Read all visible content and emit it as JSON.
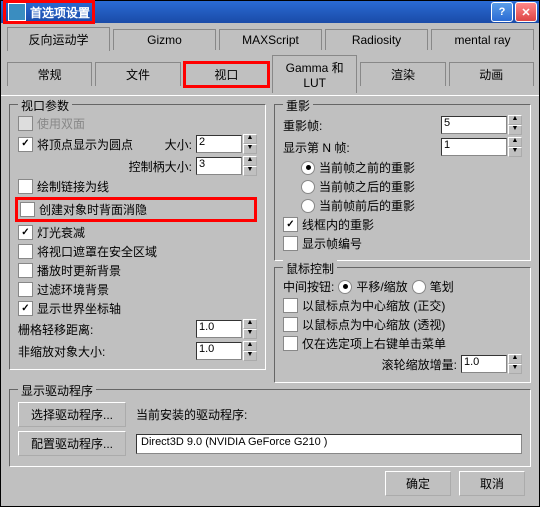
{
  "titlebar": {
    "title": "首选项设置"
  },
  "tabs_row1": [
    "反向运动学",
    "Gizmo",
    "MAXScript",
    "Radiosity",
    "mental ray"
  ],
  "tabs_row2": [
    "常规",
    "文件",
    "视口",
    "Gamma 和 LUT",
    "渲染",
    "动画"
  ],
  "active_tab": "视口",
  "vp_params": {
    "legend": "视口参数",
    "use_double": "使用双面",
    "vert_dots": "将顶点显示为圆点",
    "size_lbl": "大小:",
    "size_val": "2",
    "handle_lbl": "控制柄大小:",
    "handle_val": "3",
    "draw_links": "绘制链接为线",
    "backface": "创建对象时背面消隐",
    "light_atten": "灯光衰减",
    "safe_mask": "将视口遮罩在安全区域",
    "update_bg": "播放时更新背景",
    "filter_bg": "过滤环境背景",
    "world_axis": "显示世界坐标轴",
    "grid_dist_lbl": "栅格轻移距离:",
    "grid_dist_val": "1.0",
    "nonscale_lbl": "非缩放对象大小:",
    "nonscale_val": "1.0"
  },
  "ghost": {
    "legend": "重影",
    "frames_lbl": "重影帧:",
    "frames_val": "5",
    "nth_lbl": "显示第 N 帧:",
    "nth_val": "1",
    "before": "当前帧之前的重影",
    "after": "当前帧之后的重影",
    "both": "当前帧前后的重影",
    "wire": "线框内的重影",
    "show_num": "显示帧编号"
  },
  "mouse": {
    "legend": "鼠标控制",
    "mid_lbl": "中间按钮:",
    "pan": "平移/缩放",
    "stroke": "笔划",
    "center_ortho": "以鼠标点为中心缩放 (正交)",
    "center_persp": "以鼠标点为中心缩放 (透视)",
    "rmb_menu": "仅在选定项上右键单击菜单",
    "wheel_lbl": "滚轮缩放增量:",
    "wheel_val": "1.0"
  },
  "driver": {
    "legend": "显示驱动程序",
    "choose_btn": "选择驱动程序...",
    "installed_lbl": "当前安装的驱动程序:",
    "config_btn": "配置驱动程序...",
    "current": "Direct3D 9.0 (NVIDIA GeForce G210 )"
  },
  "footer": {
    "ok": "确定",
    "cancel": "取消"
  }
}
